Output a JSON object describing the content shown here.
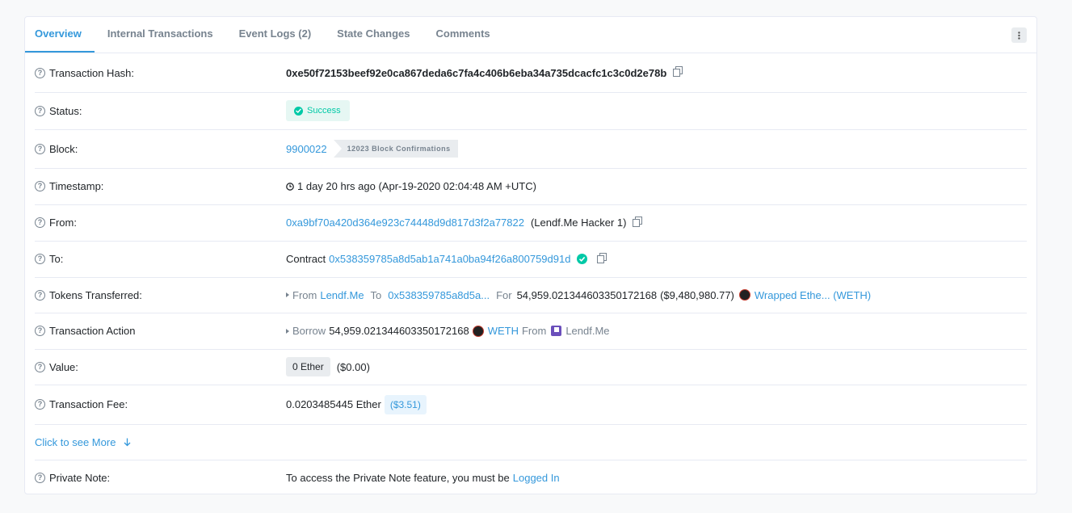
{
  "tabs": [
    {
      "label": "Overview"
    },
    {
      "label": "Internal Transactions"
    },
    {
      "label": "Event Logs (2)"
    },
    {
      "label": "State Changes"
    },
    {
      "label": "Comments"
    }
  ],
  "colors": {
    "accent": "#3498db",
    "success": "#00c9a7"
  },
  "rows": {
    "hash": {
      "label": "Transaction Hash:",
      "value": "0xe50f72153beef92e0ca867deda6c7fa4c406b6eba34a735dcacfc1c3c0d2e78b"
    },
    "status": {
      "label": "Status:",
      "value": "Success"
    },
    "block": {
      "label": "Block:",
      "number": "9900022",
      "confirmations": "12023 Block Confirmations"
    },
    "timestamp": {
      "label": "Timestamp:",
      "value": "1 day 20 hrs ago (Apr-19-2020 02:04:48 AM +UTC)"
    },
    "from": {
      "label": "From:",
      "address": "0xa9bf70a420d364e923c74448d9d817d3f2a77822",
      "name": "(Lendf.Me Hacker 1)"
    },
    "to": {
      "label": "To:",
      "prefix": "Contract",
      "address": "0x538359785a8d5ab1a741a0ba94f26a800759d91d"
    },
    "tokens": {
      "label": "Tokens Transferred:",
      "from_label": "From",
      "from_value": "Lendf.Me",
      "to_label": "To",
      "to_value": "0x538359785a8d5a...",
      "for_label": "For",
      "amount": "54,959.021344603350172168",
      "usd": "($9,480,980.77)",
      "token": "Wrapped Ethe... (WETH)"
    },
    "action": {
      "label": "Transaction Action",
      "verb": "Borrow",
      "amount": "54,959.021344603350172168",
      "token": "WETH",
      "from_label": "From",
      "from_value": "Lendf.Me"
    },
    "value": {
      "label": "Value:",
      "ether": "0 Ether",
      "usd": "($0.00)"
    },
    "fee": {
      "label": "Transaction Fee:",
      "value": "0.0203485445 Ether",
      "usd": "($3.51)"
    },
    "more": {
      "label": "Click to see More"
    },
    "note": {
      "label": "Private Note:",
      "text": "To access the Private Note feature, you must be",
      "link": "Logged In"
    }
  },
  "icons": {
    "help": "question-circle-icon",
    "copy": "copy-icon",
    "clock": "clock-icon",
    "verified": "check-circle-icon",
    "menu": "kebab-menu-icon",
    "arrow": "arrow-down-icon"
  }
}
